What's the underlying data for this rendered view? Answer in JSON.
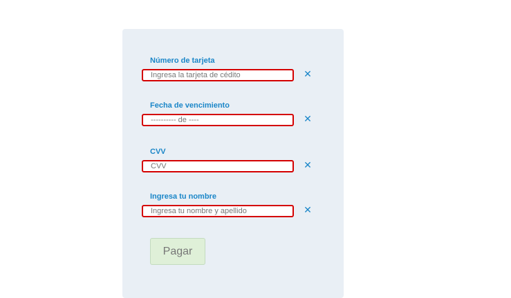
{
  "form": {
    "fields": [
      {
        "label": "Número de tarjeta",
        "value": "",
        "placeholder": "Ingresa la tarjeta de cédito"
      },
      {
        "label": "Fecha de vencimiento",
        "value": "",
        "placeholder": "---------- de ----"
      },
      {
        "label": "CVV",
        "value": "",
        "placeholder": "CVV"
      },
      {
        "label": "Ingresa tu nombre",
        "value": "",
        "placeholder": "Ingresa tu nombre y apellido"
      }
    ],
    "clear_glyph": "✕",
    "pay_label": "Pagar"
  },
  "colors": {
    "label": "#1a86c8",
    "input_border_error": "#d40000",
    "panel_bg": "#e9eff5",
    "button_bg": "#dff0d8"
  },
  "icons": {
    "clear": "close-icon"
  }
}
